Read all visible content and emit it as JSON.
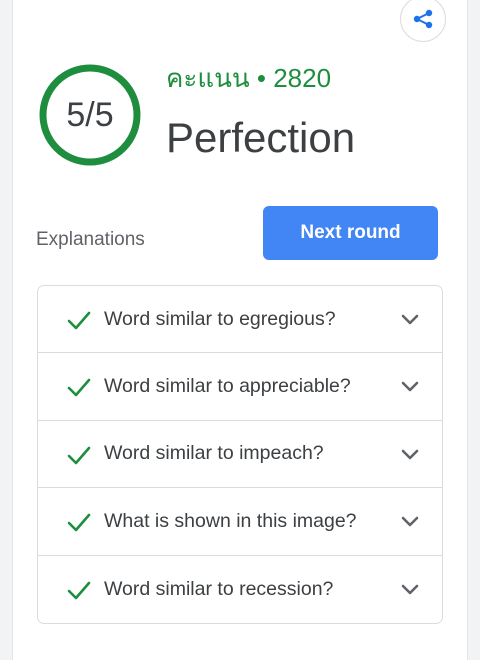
{
  "result": {
    "score": "5/5",
    "points_label": "คะแนน • 2820",
    "title": "Perfection",
    "score_fraction": 1.0
  },
  "actions": {
    "explanations_label": "Explanations",
    "next_round_label": "Next round"
  },
  "questions": [
    {
      "text": "Word similar to egregious?",
      "correct": true
    },
    {
      "text": "Word similar to appreciable?",
      "correct": true
    },
    {
      "text": "Word similar to impeach?",
      "correct": true
    },
    {
      "text": "What is shown in this image?",
      "correct": true
    },
    {
      "text": "Word similar to recession?",
      "correct": true
    }
  ],
  "icons": {
    "share": "share-icon",
    "check": "check-icon",
    "expand": "chevron-down-icon"
  },
  "colors": {
    "accent_green": "#1e8e3e",
    "button_blue": "#4285f4",
    "text_dark": "#3c4043",
    "text_muted": "#5f6368"
  }
}
